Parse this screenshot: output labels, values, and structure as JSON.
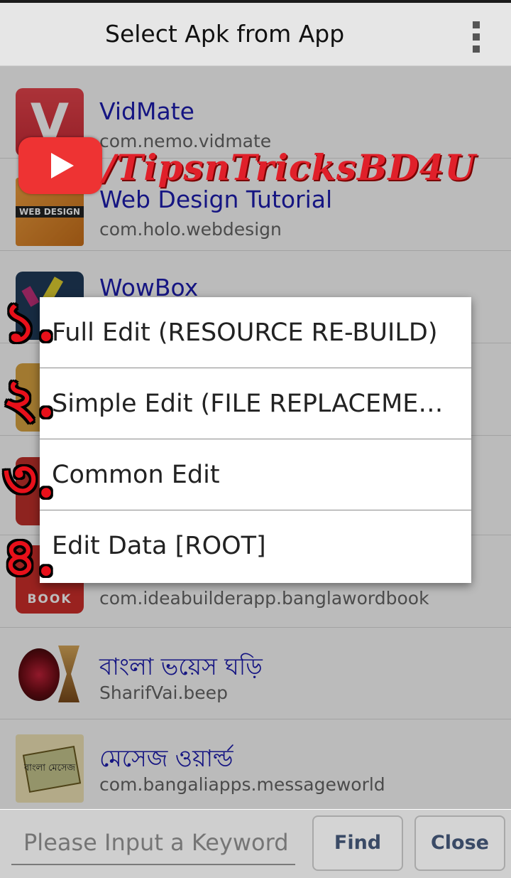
{
  "header": {
    "title": "Select Apk from App",
    "menu_icon": "overflow-menu-icon"
  },
  "apps": [
    {
      "name": "VidMate",
      "package": "com.nemo.vidmate",
      "icon_color": "#e0434b",
      "icon_text": "V"
    },
    {
      "name": "Web Design Tutorial",
      "package": "com.holo.webdesign",
      "icon_color": "#e58a2c",
      "icon_text": "WEB DESIGN"
    },
    {
      "name": "WowBox",
      "package": "",
      "icon_color": "#1f3a5a",
      "icon_text": ""
    },
    {
      "name": "",
      "package": "",
      "icon_color": "#d9a441",
      "icon_text": ""
    },
    {
      "name": "",
      "package": "",
      "icon_color": "#c0302a",
      "icon_text": ""
    },
    {
      "name": "",
      "package": "com.ideabuilderapp.banglawordbook",
      "icon_color": "#cf2f2a",
      "icon_text": "BOOK"
    },
    {
      "name": "বাংলা ভয়েস ঘড়ি",
      "package": "SharifVai.beep",
      "icon_color": "#5a1010",
      "icon_text": ""
    },
    {
      "name": "মেসেজ ওয়ার্ল্ড",
      "package": "com.bangaliapps.messageworld",
      "icon_color": "#c9a75a",
      "icon_text": "বাংলা মেসেজ"
    }
  ],
  "watermark": {
    "text": "/TipsnTricksBD4U",
    "logo": "youtube-play-icon"
  },
  "dialog": {
    "items": [
      {
        "label": "Full Edit (RESOURCE RE-BUILD)",
        "number": "১."
      },
      {
        "label": "Simple Edit (FILE REPLACEMENT)",
        "number": "২."
      },
      {
        "label": "Common Edit",
        "number": "৩."
      },
      {
        "label": "Edit Data [ROOT]",
        "number": "৪."
      }
    ]
  },
  "footer": {
    "search_placeholder": "Please Input a Keyword",
    "find_label": "Find",
    "close_label": "Close"
  }
}
